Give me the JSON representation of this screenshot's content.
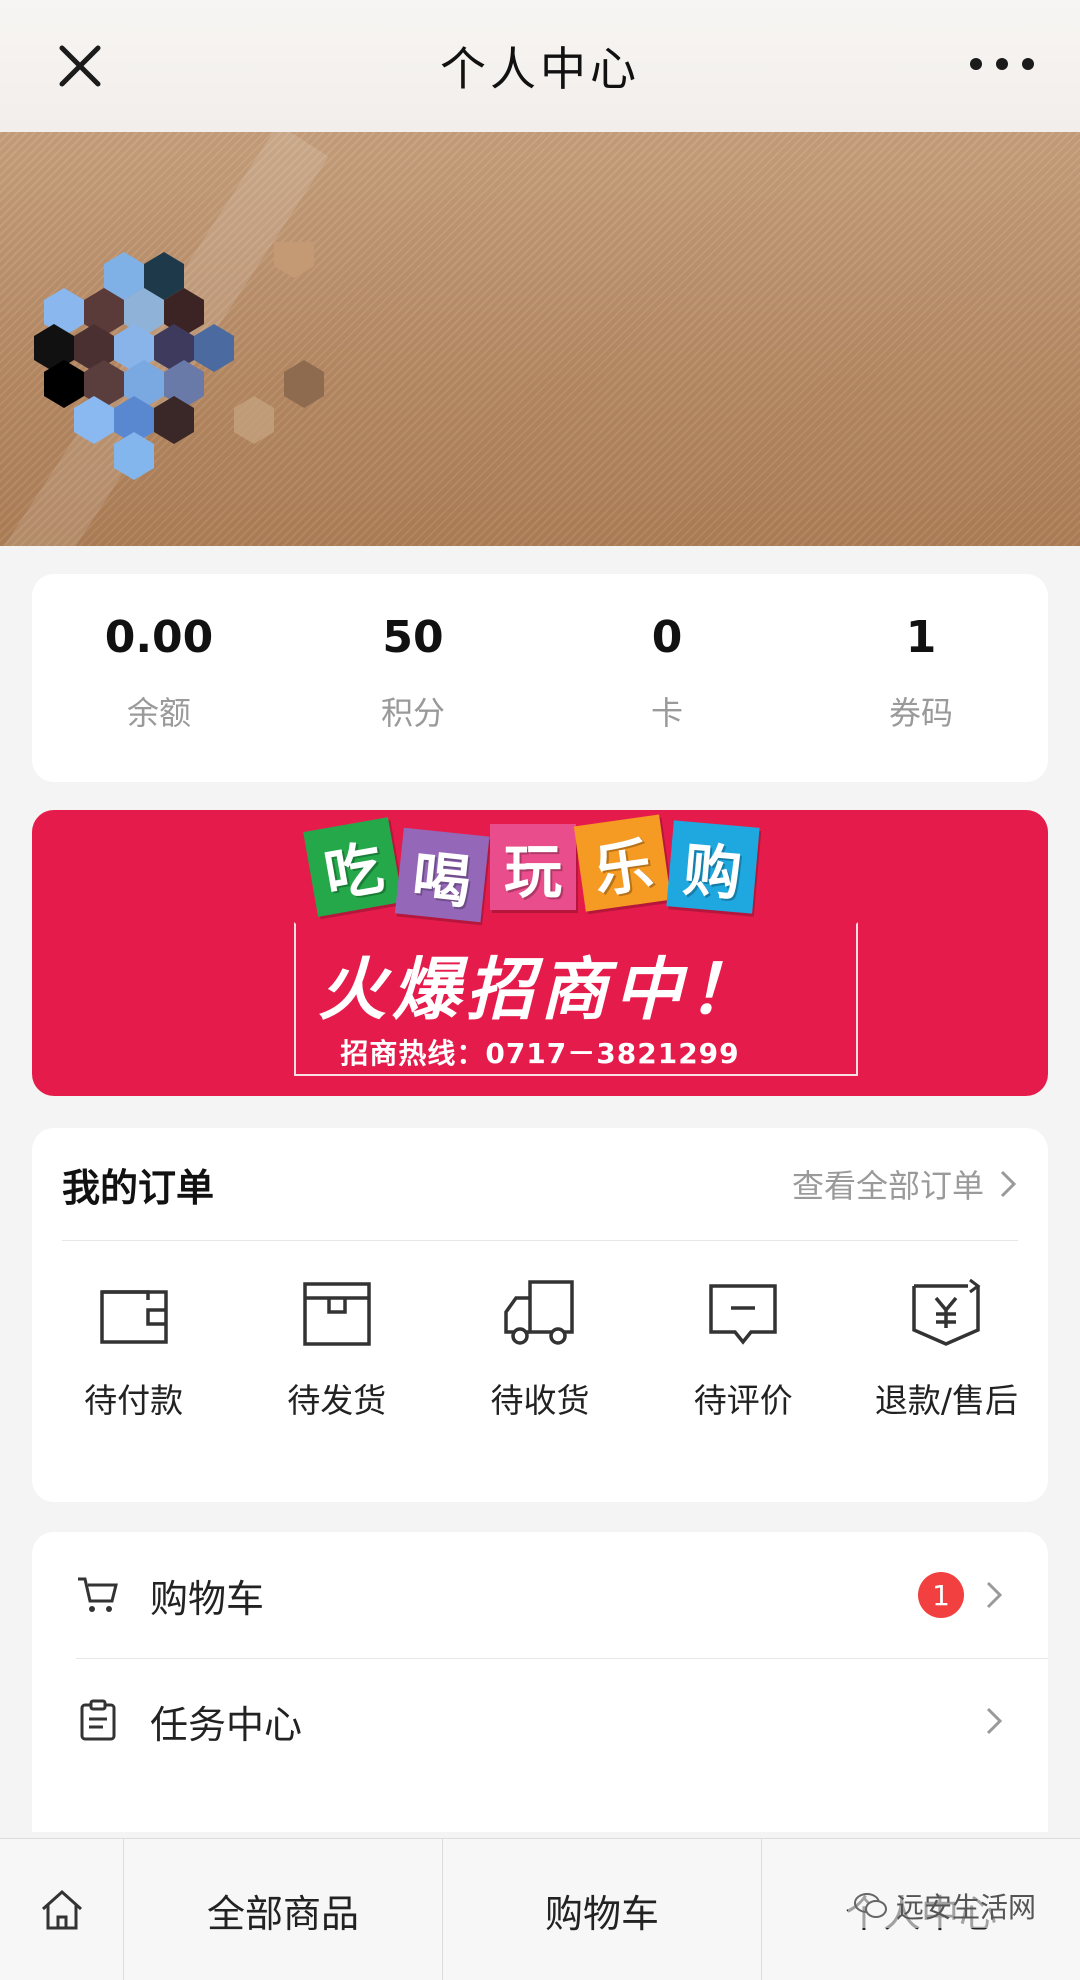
{
  "header": {
    "title": "个人中心"
  },
  "stats": [
    {
      "value": "0.00",
      "label": "余额"
    },
    {
      "value": "50",
      "label": "积分"
    },
    {
      "value": "0",
      "label": "卡"
    },
    {
      "value": "1",
      "label": "券码"
    }
  ],
  "ad_banner": {
    "tiles": [
      "吃",
      "喝",
      "玩",
      "乐",
      "购"
    ],
    "headline": "火爆招商中！",
    "hotline": "招商热线：0717－3821299",
    "background_color": "#e51c4b"
  },
  "orders": {
    "title": "我的订单",
    "view_all": "查看全部订单",
    "items": [
      {
        "label": "待付款",
        "icon": "wallet-icon"
      },
      {
        "label": "待发货",
        "icon": "box-icon"
      },
      {
        "label": "待收货",
        "icon": "truck-icon"
      },
      {
        "label": "待评价",
        "icon": "comment-icon"
      },
      {
        "label": "退款/售后",
        "icon": "refund-icon"
      }
    ]
  },
  "menu": {
    "items": [
      {
        "label": "购物车",
        "icon": "cart-icon",
        "badge": "1"
      },
      {
        "label": "任务中心",
        "icon": "clipboard-icon"
      }
    ]
  },
  "tabbar": {
    "items": [
      "全部商品",
      "购物车",
      "个人中心"
    ]
  },
  "watermark": "远安生活网",
  "colors": {
    "accent_red": "#f24040",
    "banner_brown": "#b68963"
  }
}
